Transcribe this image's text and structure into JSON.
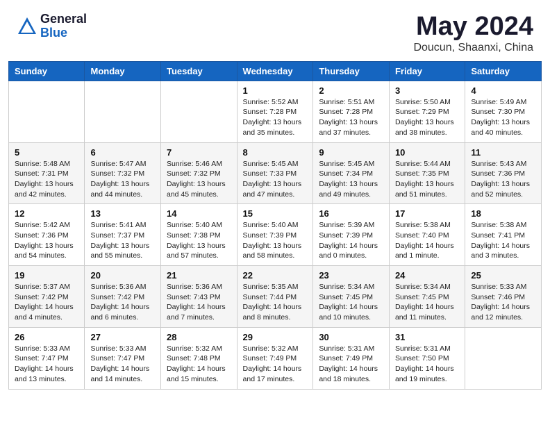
{
  "header": {
    "logo_general": "General",
    "logo_blue": "Blue",
    "month_year": "May 2024",
    "location": "Doucun, Shaanxi, China"
  },
  "weekdays": [
    "Sunday",
    "Monday",
    "Tuesday",
    "Wednesday",
    "Thursday",
    "Friday",
    "Saturday"
  ],
  "weeks": [
    [
      {
        "day": "",
        "detail": ""
      },
      {
        "day": "",
        "detail": ""
      },
      {
        "day": "",
        "detail": ""
      },
      {
        "day": "1",
        "detail": "Sunrise: 5:52 AM\nSunset: 7:28 PM\nDaylight: 13 hours\nand 35 minutes."
      },
      {
        "day": "2",
        "detail": "Sunrise: 5:51 AM\nSunset: 7:28 PM\nDaylight: 13 hours\nand 37 minutes."
      },
      {
        "day": "3",
        "detail": "Sunrise: 5:50 AM\nSunset: 7:29 PM\nDaylight: 13 hours\nand 38 minutes."
      },
      {
        "day": "4",
        "detail": "Sunrise: 5:49 AM\nSunset: 7:30 PM\nDaylight: 13 hours\nand 40 minutes."
      }
    ],
    [
      {
        "day": "5",
        "detail": "Sunrise: 5:48 AM\nSunset: 7:31 PM\nDaylight: 13 hours\nand 42 minutes."
      },
      {
        "day": "6",
        "detail": "Sunrise: 5:47 AM\nSunset: 7:32 PM\nDaylight: 13 hours\nand 44 minutes."
      },
      {
        "day": "7",
        "detail": "Sunrise: 5:46 AM\nSunset: 7:32 PM\nDaylight: 13 hours\nand 45 minutes."
      },
      {
        "day": "8",
        "detail": "Sunrise: 5:45 AM\nSunset: 7:33 PM\nDaylight: 13 hours\nand 47 minutes."
      },
      {
        "day": "9",
        "detail": "Sunrise: 5:45 AM\nSunset: 7:34 PM\nDaylight: 13 hours\nand 49 minutes."
      },
      {
        "day": "10",
        "detail": "Sunrise: 5:44 AM\nSunset: 7:35 PM\nDaylight: 13 hours\nand 51 minutes."
      },
      {
        "day": "11",
        "detail": "Sunrise: 5:43 AM\nSunset: 7:36 PM\nDaylight: 13 hours\nand 52 minutes."
      }
    ],
    [
      {
        "day": "12",
        "detail": "Sunrise: 5:42 AM\nSunset: 7:36 PM\nDaylight: 13 hours\nand 54 minutes."
      },
      {
        "day": "13",
        "detail": "Sunrise: 5:41 AM\nSunset: 7:37 PM\nDaylight: 13 hours\nand 55 minutes."
      },
      {
        "day": "14",
        "detail": "Sunrise: 5:40 AM\nSunset: 7:38 PM\nDaylight: 13 hours\nand 57 minutes."
      },
      {
        "day": "15",
        "detail": "Sunrise: 5:40 AM\nSunset: 7:39 PM\nDaylight: 13 hours\nand 58 minutes."
      },
      {
        "day": "16",
        "detail": "Sunrise: 5:39 AM\nSunset: 7:39 PM\nDaylight: 14 hours\nand 0 minutes."
      },
      {
        "day": "17",
        "detail": "Sunrise: 5:38 AM\nSunset: 7:40 PM\nDaylight: 14 hours\nand 1 minute."
      },
      {
        "day": "18",
        "detail": "Sunrise: 5:38 AM\nSunset: 7:41 PM\nDaylight: 14 hours\nand 3 minutes."
      }
    ],
    [
      {
        "day": "19",
        "detail": "Sunrise: 5:37 AM\nSunset: 7:42 PM\nDaylight: 14 hours\nand 4 minutes."
      },
      {
        "day": "20",
        "detail": "Sunrise: 5:36 AM\nSunset: 7:42 PM\nDaylight: 14 hours\nand 6 minutes."
      },
      {
        "day": "21",
        "detail": "Sunrise: 5:36 AM\nSunset: 7:43 PM\nDaylight: 14 hours\nand 7 minutes."
      },
      {
        "day": "22",
        "detail": "Sunrise: 5:35 AM\nSunset: 7:44 PM\nDaylight: 14 hours\nand 8 minutes."
      },
      {
        "day": "23",
        "detail": "Sunrise: 5:34 AM\nSunset: 7:45 PM\nDaylight: 14 hours\nand 10 minutes."
      },
      {
        "day": "24",
        "detail": "Sunrise: 5:34 AM\nSunset: 7:45 PM\nDaylight: 14 hours\nand 11 minutes."
      },
      {
        "day": "25",
        "detail": "Sunrise: 5:33 AM\nSunset: 7:46 PM\nDaylight: 14 hours\nand 12 minutes."
      }
    ],
    [
      {
        "day": "26",
        "detail": "Sunrise: 5:33 AM\nSunset: 7:47 PM\nDaylight: 14 hours\nand 13 minutes."
      },
      {
        "day": "27",
        "detail": "Sunrise: 5:33 AM\nSunset: 7:47 PM\nDaylight: 14 hours\nand 14 minutes."
      },
      {
        "day": "28",
        "detail": "Sunrise: 5:32 AM\nSunset: 7:48 PM\nDaylight: 14 hours\nand 15 minutes."
      },
      {
        "day": "29",
        "detail": "Sunrise: 5:32 AM\nSunset: 7:49 PM\nDaylight: 14 hours\nand 17 minutes."
      },
      {
        "day": "30",
        "detail": "Sunrise: 5:31 AM\nSunset: 7:49 PM\nDaylight: 14 hours\nand 18 minutes."
      },
      {
        "day": "31",
        "detail": "Sunrise: 5:31 AM\nSunset: 7:50 PM\nDaylight: 14 hours\nand 19 minutes."
      },
      {
        "day": "",
        "detail": ""
      }
    ]
  ]
}
